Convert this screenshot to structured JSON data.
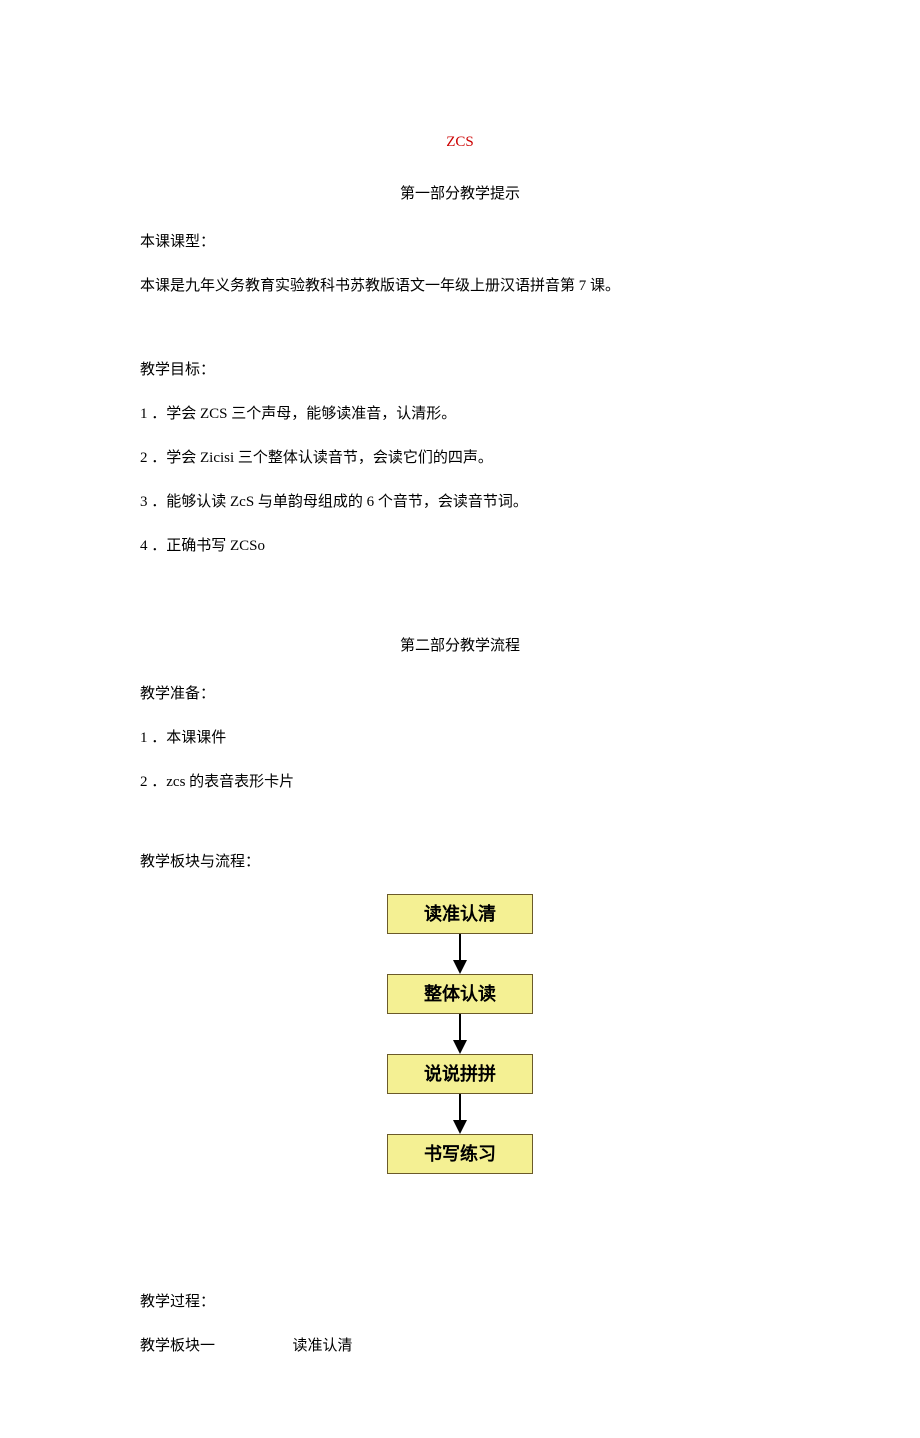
{
  "title": "ZCS",
  "section1": {
    "header": "第一部分教学提示",
    "courseTypeLabel": "本课课型：",
    "courseTypeDesc": "本课是九年义务教育实验教科书苏教版语文一年级上册汉语拼音第 7 课。",
    "objectivesLabel": "教学目标：",
    "objectives": [
      "1 ．学会 ZCS 三个声母，能够读准音，认清形。",
      "2 ．学会 Zicisi 三个整体认读音节，会读它们的四声。",
      "3 ．能够认读 ZcS 与单韵母组成的 6 个音节，会读音节词。",
      "4 ．正确书写 ZCSo"
    ]
  },
  "section2": {
    "header": "第二部分教学流程",
    "prepLabel": "教学准备：",
    "prepItems": [
      "1 ．本课课件",
      "2 ．zcs 的表音表形卡片"
    ],
    "flowLabel": "教学板块与流程：",
    "flowBoxes": [
      "读准认清",
      "整体认读",
      "说说拼拼",
      "书写练习"
    ]
  },
  "section3": {
    "processLabel": "教学过程：",
    "block1Label": "教学板块一",
    "block1Title": "读准认清"
  }
}
